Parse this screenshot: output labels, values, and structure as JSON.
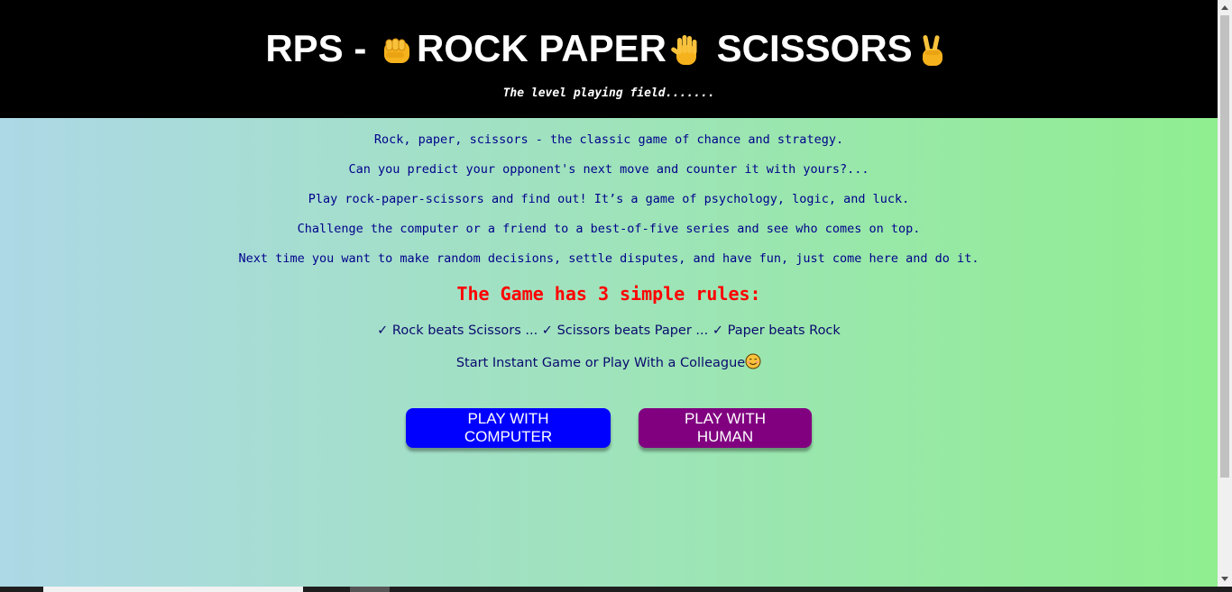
{
  "header": {
    "title_prefix": "RPS - ",
    "title_rock": "ROCK",
    "title_paper": "PAPER",
    "title_scissors": "SCISSORS",
    "tagline": "The level playing field......."
  },
  "intro": [
    "Rock, paper, scissors - the classic game of chance and strategy.",
    "Can you predict your opponent's next move and counter it with yours?...",
    "Play rock-paper-scissors and find out! It’s a game of psychology, logic, and luck.",
    "Challenge the computer or a friend to a best-of-five series and see who comes on top.",
    "Next time you want to make random decisions, settle disputes, and have fun, just come here and do it."
  ],
  "rules": {
    "heading": "The Game has 3 simple rules:",
    "line": "✓ Rock beats Scissors ... ✓ Scissors beats Paper ... ✓ Paper beats Rock",
    "start": "Start Instant Game or Play With a Colleague"
  },
  "buttons": {
    "computer": "PLAY WITH COMPUTER",
    "human": "PLAY WITH HUMAN"
  },
  "icons": {
    "rock": "fist-emoji-icon",
    "paper": "raised-hand-emoji-icon",
    "scissors": "victory-hand-emoji-icon",
    "smile": "smiling-face-emoji-icon"
  },
  "colors": {
    "header_bg": "#000000",
    "gradient_start": "#add8e6",
    "gradient_end": "#90ee90",
    "text": "#00008b",
    "rules_heading": "#ff0000",
    "button_computer": "#0000ff",
    "button_human": "#800080"
  }
}
